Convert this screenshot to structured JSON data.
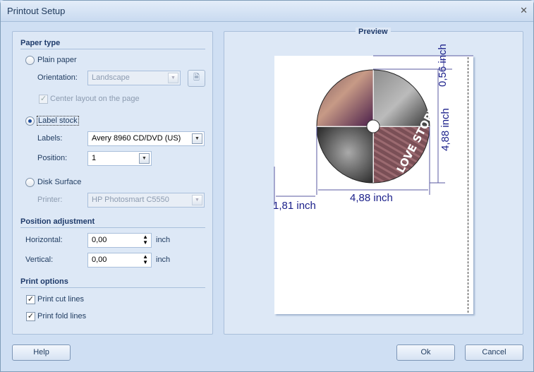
{
  "window": {
    "title": "Printout Setup",
    "close": "✕"
  },
  "paper_type": {
    "heading": "Paper type",
    "plain_paper": "Plain paper",
    "orientation_label": "Orientation:",
    "orientation_value": "Landscape",
    "center_layout": "Center layout on the page",
    "label_stock": "Label stock",
    "labels_label": "Labels:",
    "labels_value": "Avery 8960 CD/DVD (US)",
    "position_label": "Position:",
    "position_value": "1",
    "disk_surface": "Disk Surface",
    "printer_label": "Printer:",
    "printer_value": "HP Photosmart C5550",
    "selected": "Label stock"
  },
  "position_adjustment": {
    "heading": "Position adjustment",
    "horizontal_label": "Horizontal:",
    "horizontal_value": "0,00",
    "vertical_label": "Vertical:",
    "vertical_value": "0,00",
    "unit": "inch"
  },
  "print_options": {
    "heading": "Print options",
    "cut_lines": "Print cut lines",
    "fold_lines": "Print fold lines",
    "cut_checked": true,
    "fold_checked": true
  },
  "preview": {
    "heading": "Preview",
    "dim_top": "0,56 inch",
    "dim_height": "4,88 inch",
    "dim_width": "4,88 inch",
    "dim_left": "1,81 inch",
    "label_text": "LOVE STORY"
  },
  "buttons": {
    "help": "Help",
    "ok": "Ok",
    "cancel": "Cancel"
  }
}
